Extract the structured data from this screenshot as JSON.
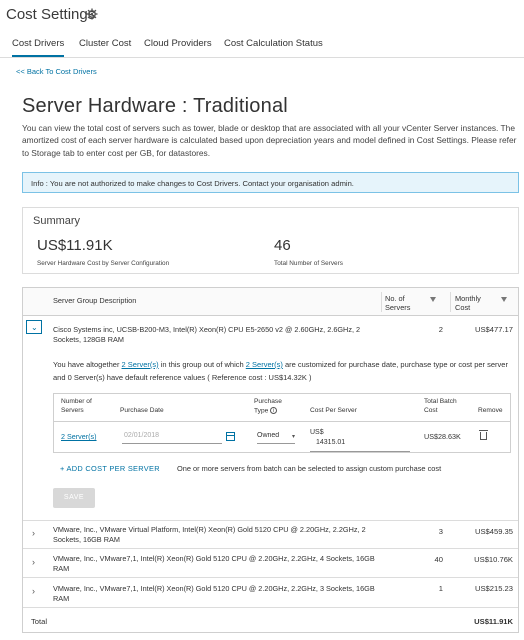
{
  "app": {
    "title": "Cost Settings",
    "settings_icon": "gear-icon"
  },
  "tabs": [
    {
      "label": "Cost Drivers",
      "active": true
    },
    {
      "label": "Cluster Cost",
      "active": false
    },
    {
      "label": "Cloud Providers",
      "active": false
    },
    {
      "label": "Cost Calculation Status",
      "active": false
    }
  ],
  "back_link": "<< Back To Cost Drivers",
  "page": {
    "title": "Server Hardware : Traditional",
    "description": "You can view the total cost of servers such as tower, blade or desktop that are associated with all your vCenter Server instances. The amortized cost of each server hardware is calculated based upon depreciation years and model defined in Cost Settings. Please refer to Storage tab to enter cost per GB, for datastores."
  },
  "info_message": "Info : You are not authorized to make changes to Cost Drivers. Contact your organisation admin.",
  "summary": {
    "title": "Summary",
    "cost_value": "US$11.91K",
    "cost_label": "Server Hardware Cost by Server Configuration",
    "servers_value": "46",
    "servers_label": "Total Number of Servers"
  },
  "grid": {
    "columns": {
      "description": "Server Group Description",
      "servers": "No. of Servers",
      "cost": "Monthly Cost"
    },
    "rows": [
      {
        "description": "Cisco Systems inc, UCSB-B200-M3, Intel(R) Xeon(R) CPU E5-2650 v2 @ 2.60GHz, 2.6GHz, 2 Sockets, 128GB RAM",
        "servers": "2",
        "cost": "US$477.17",
        "expanded": true
      },
      {
        "description": "VMware, Inc., VMware Virtual Platform, Intel(R) Xeon(R) Gold 5120 CPU @ 2.20GHz, 2.2GHz, 2 Sockets, 16GB RAM",
        "servers": "3",
        "cost": "US$459.35"
      },
      {
        "description": "VMware, Inc., VMware7,1, Intel(R) Xeon(R) Gold 5120 CPU @ 2.20GHz, 2.2GHz, 4 Sockets, 16GB RAM",
        "servers": "40",
        "cost": "US$10.76K"
      },
      {
        "description": "VMware, Inc., VMware7,1, Intel(R) Xeon(R) Gold 5120 CPU @ 2.20GHz, 2.2GHz, 3 Sockets, 16GB RAM",
        "servers": "1",
        "cost": "US$215.23"
      }
    ],
    "total_label": "Total",
    "total_value": "US$11.91K"
  },
  "detail": {
    "text_1": "You have altogether ",
    "link_1": "2 Server(s)",
    "text_2": " in this group out of which ",
    "link_2": "2 Server(s)",
    "text_3": " are customized for purchase date, purchase type or cost per server and 0 Server(s) have default reference values ( Reference cost : US$14.32K )",
    "columns": {
      "number": "Number of Servers",
      "date": "Purchase Date",
      "type": "Purchase Type",
      "cost": "Cost Per Server",
      "batch": "Total Batch Cost",
      "remove": "Remove"
    },
    "row": {
      "number": "2 Server(s)",
      "date": "02/01/2018",
      "type": "Owned",
      "cost_currency": "US$",
      "cost_value": "14315.01",
      "batch": "US$28.63K"
    },
    "add_label": "+ ADD COST PER SERVER",
    "add_hint": "One or more servers from batch can be selected to assign custom purchase cost",
    "save_label": "SAVE"
  },
  "colors": {
    "accent": "#0072a3",
    "info_bg": "#e6f4fb",
    "info_border": "#7bc2e6"
  }
}
